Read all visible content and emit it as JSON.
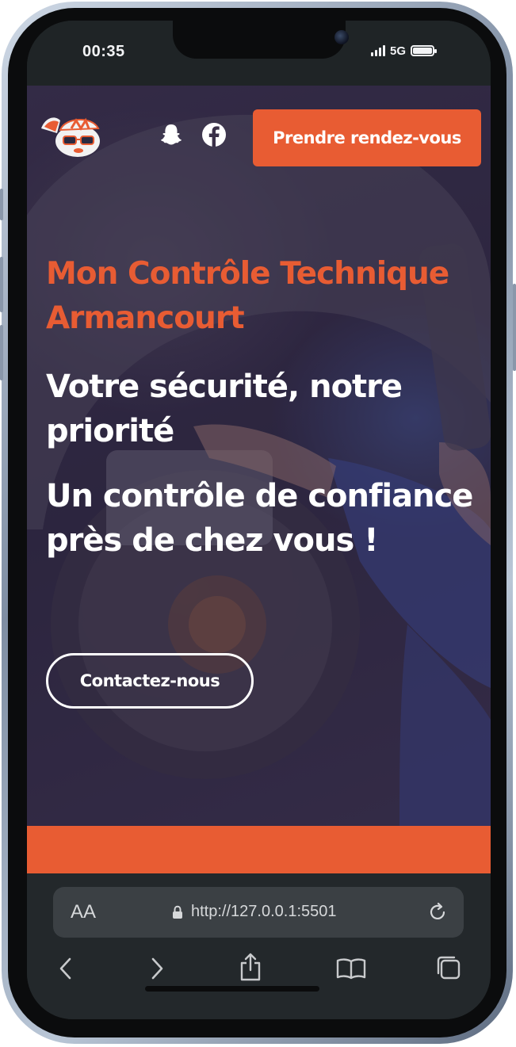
{
  "status_bar": {
    "time": "00:35",
    "network": "5G"
  },
  "header": {
    "cta_label": "Prendre rendez-vous",
    "social": [
      "snapchat-icon",
      "facebook-icon"
    ]
  },
  "hero": {
    "title": "Mon Contrôle Technique Armancourt",
    "subtitle_1": "Votre sécurité, notre priorité",
    "subtitle_2": "Un contrôle de confiance près de chez vous !",
    "contact_label": "Contactez-nous"
  },
  "browser": {
    "text_size_label": "AA",
    "url": "http://127.0.0.1:5501"
  },
  "colors": {
    "accent": "#e85c33",
    "overlay": "#2a1f45"
  }
}
